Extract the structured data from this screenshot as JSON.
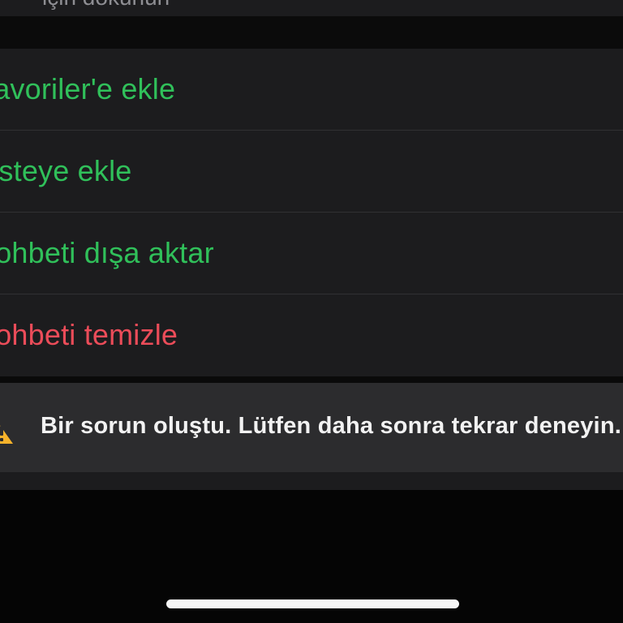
{
  "top_cell": {
    "partial_text": "için dokunun"
  },
  "menu": {
    "items": [
      {
        "label": "Favoriler'e ekle",
        "color": "#30c05a"
      },
      {
        "label": "Listeye ekle",
        "color": "#30c05a"
      },
      {
        "label": "Sohbeti dışa aktar",
        "color": "#30c05a"
      },
      {
        "label": "Sohbeti temizle",
        "color": "#eb4c59"
      }
    ]
  },
  "error_banner": {
    "icon": "warning-triangle-icon",
    "message": "Bir sorun oluştu. Lütfen daha sonra tekrar deneyin.",
    "icon_color": "#f7b32b"
  },
  "colors": {
    "background": "#050505",
    "cell": "#1c1c1e",
    "banner": "#2c2c2e",
    "action_green": "#30c05a",
    "destructive_red": "#eb4c59"
  }
}
